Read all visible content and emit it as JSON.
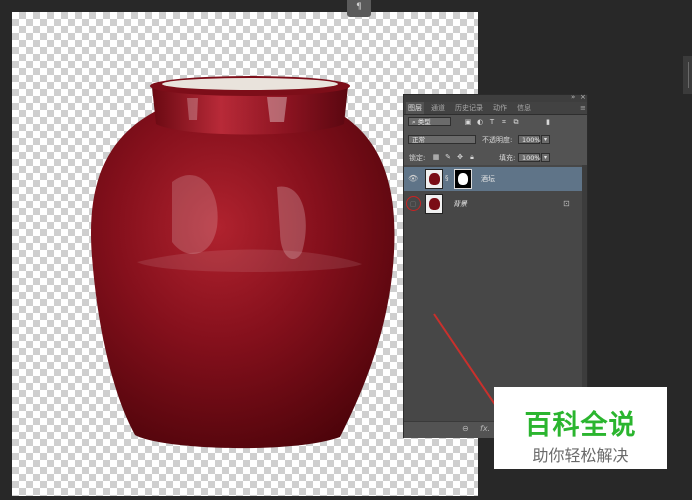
{
  "panel": {
    "tabs": [
      "图层",
      "通道",
      "历史记录",
      "动作",
      "信息"
    ],
    "filter": {
      "label": "类型"
    },
    "blend_mode": {
      "value": "正常"
    },
    "opacity": {
      "label": "不透明度:",
      "value": "100%"
    },
    "lock": {
      "label": "锁定:"
    },
    "fill": {
      "label": "填充:",
      "value": "100%"
    },
    "layers": [
      {
        "name": "酒坛",
        "selected": true,
        "visible": true
      },
      {
        "name": "背景",
        "selected": false,
        "visible": false,
        "locked": true
      }
    ],
    "footer": {
      "link_icon": "⊖",
      "fx_label": "fx."
    }
  },
  "watermark": {
    "title": "百科全说",
    "subtitle": "助你轻松解决"
  },
  "colors": {
    "watermark_green": "#2bb52f",
    "jar_red": "#7a0d16",
    "selected_layer": "#5f7488",
    "annotation_red": "#cc2222"
  },
  "icons": [
    "paragraph-icon",
    "eye-icon",
    "lock-icon",
    "chain-icon",
    "fx-icon"
  ]
}
